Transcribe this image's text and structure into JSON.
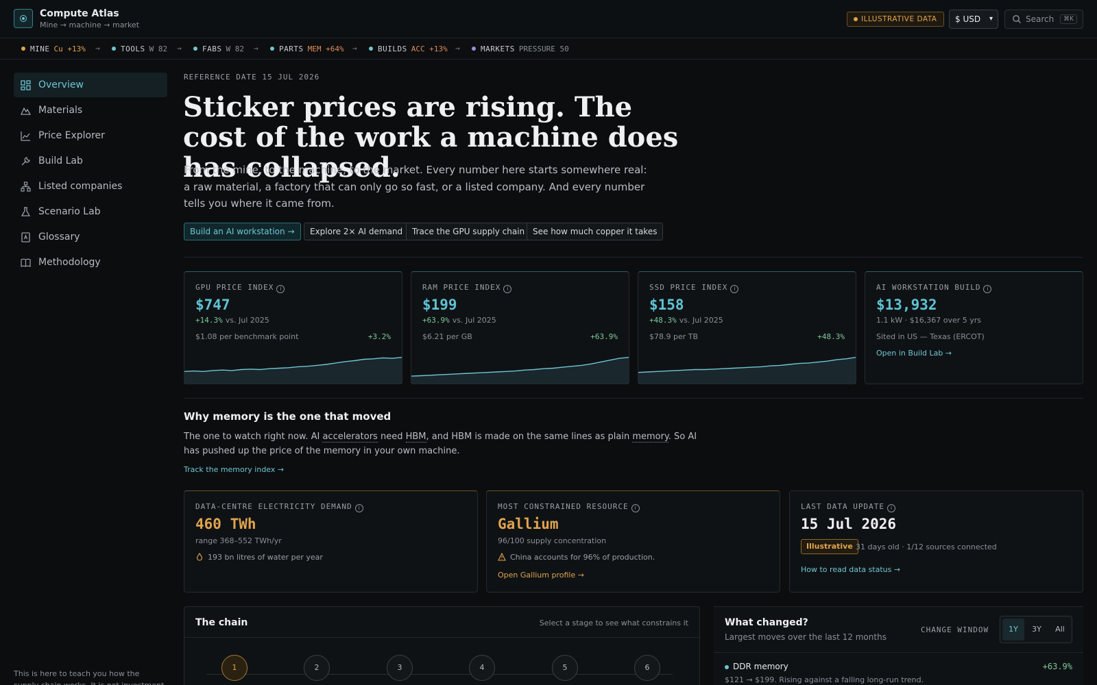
{
  "header": {
    "title": "Compute Atlas",
    "subtitle": "Mine → machine → market",
    "badge": "ILLUSTRATIVE DATA",
    "currency": "$ USD",
    "search_placeholder": "Search",
    "search_shortcut": "⌘K"
  },
  "ribbon": [
    {
      "name": "MINE",
      "value": "Cu +13%",
      "color": "#e0a44e"
    },
    {
      "name": "TOOLS",
      "value": "W 82",
      "color": "#6fc6d4"
    },
    {
      "name": "FABS",
      "value": "W 82",
      "color": "#6fc6d4"
    },
    {
      "name": "PARTS",
      "value": "MEM +64%",
      "color": "#6fc6d4"
    },
    {
      "name": "BUILDS",
      "value": "ACC +13%",
      "color": "#6fc6d4"
    },
    {
      "name": "MARKETS",
      "value": "PRESSURE 50",
      "color": "#9b8fd9"
    }
  ],
  "ribbon_arrow": "→",
  "sidebar": {
    "items": [
      {
        "label": "Overview",
        "icon": "dashboard-icon"
      },
      {
        "label": "Materials",
        "icon": "mountain-icon"
      },
      {
        "label": "Price Explorer",
        "icon": "line-chart-icon"
      },
      {
        "label": "Build Lab",
        "icon": "wrench-icon"
      },
      {
        "label": "Listed companies",
        "icon": "org-chart-icon"
      },
      {
        "label": "Scenario Lab",
        "icon": "flask-icon"
      },
      {
        "label": "Glossary",
        "icon": "book-letter-icon"
      },
      {
        "label": "Methodology",
        "icon": "open-book-icon"
      }
    ],
    "footer": "This is here to teach you how the supply chain works. It is not investment advice."
  },
  "hero": {
    "ref_date": "REFERENCE DATE 15 JUL 2026",
    "headline": "Sticker prices are rising. The cost of the work a machine does has collapsed.",
    "lede": "From the mine, to the machine, to the market. Every number here starts somewhere real: a raw material, a factory that can only go so fast, or a listed company. And every number tells you where it came from.",
    "ctas": [
      "Build an AI workstation",
      "Explore 2× AI demand",
      "Trace the GPU supply chain",
      "See how much copper it takes"
    ]
  },
  "index_cards": [
    {
      "label": "GPU PRICE INDEX",
      "value": "$747",
      "change": "+14.3%",
      "vs": "vs. Jul 2025",
      "unit": "$1.08 per benchmark point",
      "spark_delta": "+3.2%",
      "spark": [
        20,
        21,
        20,
        22,
        23,
        22,
        24,
        25,
        24,
        26,
        27,
        28,
        30,
        31,
        33,
        35,
        38,
        41,
        43,
        46,
        47,
        49,
        48,
        50
      ]
    },
    {
      "label": "RAM PRICE INDEX",
      "value": "$199",
      "change": "+63.9%",
      "vs": "vs. Jul 2025",
      "unit": "$6.21 per GB",
      "spark_delta": "+63.9%",
      "spark": [
        10,
        11,
        12,
        13,
        14,
        15,
        16,
        17,
        18,
        19,
        20,
        21,
        23,
        24,
        26,
        27,
        29,
        31,
        33,
        36,
        40,
        44,
        48,
        50
      ]
    },
    {
      "label": "SSD PRICE INDEX",
      "value": "$158",
      "change": "+48.3%",
      "vs": "vs. Jul 2025",
      "unit": "$78.9 per TB",
      "spark_delta": "+48.3%",
      "spark": [
        18,
        19,
        20,
        21,
        22,
        23,
        24,
        24,
        25,
        26,
        27,
        28,
        29,
        30,
        32,
        33,
        35,
        37,
        38,
        40,
        42,
        45,
        47,
        50
      ]
    },
    {
      "label": "AI WORKSTATION BUILD",
      "value": "$13,932",
      "meta": "1.1 kW · $16,367 over 5 yrs",
      "sited": "Sited in US — Texas (ERCOT)",
      "link": "Open in Build Lab"
    }
  ],
  "why": {
    "title": "Why memory is the one that moved",
    "text_a": "The one to watch right now. AI ",
    "term_1": "accelerators",
    "text_b": " need ",
    "term_2": "HBM",
    "text_c": ", and HBM is made on the same lines as plain ",
    "term_3": "memory",
    "text_d": ". So AI has pushed up the price of the memory in your own machine.",
    "link": "Track the memory index →"
  },
  "stat_cards": {
    "electricity": {
      "label": "DATA-CENTRE ELECTRICITY DEMAND",
      "value": "460 TWh",
      "range": "range 368–552 TWh/yr",
      "note": "193 bn litres of water per year"
    },
    "constrained": {
      "label": "MOST CONSTRAINED RESOURCE",
      "value": "Gallium",
      "concentration": "96/100 supply concentration",
      "note": "China accounts for 96% of production.",
      "link": "Open Gallium profile"
    },
    "update": {
      "label": "LAST DATA UPDATE",
      "value": "15 Jul 2026",
      "status": "Illustrative",
      "meta": "31 days old · 1/12 sources connected",
      "link": "How to read data status"
    }
  },
  "chain": {
    "title": "The chain",
    "hint": "Select a stage to see what constrains it",
    "stages": [
      "1",
      "2",
      "3",
      "4",
      "5",
      "6"
    ]
  },
  "changed": {
    "title": "What changed?",
    "subtitle": "Largest moves over the last 12 months",
    "window_label": "CHANGE WINDOW",
    "windows": [
      "1Y",
      "3Y",
      "All"
    ],
    "rows": [
      {
        "name": "DDR memory",
        "delta": "+63.9%",
        "desc": "$121 → $199. Rising against a falling long-run trend."
      }
    ]
  },
  "colors": {
    "accent": "#6fc6d4",
    "positive": "#7fc99a",
    "warning": "#e0a44e",
    "background": "#0b0d0f"
  }
}
